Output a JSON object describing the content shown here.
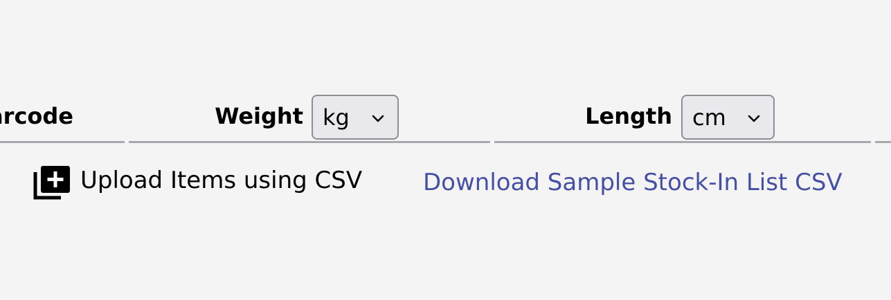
{
  "headers": {
    "barcode": "arcode",
    "weight": "Weight",
    "length": "Length"
  },
  "units": {
    "weight": {
      "selected": "kg"
    },
    "length": {
      "selected": "cm"
    }
  },
  "upload": {
    "label": "Upload Items using CSV",
    "icon": "library-add-icon"
  },
  "download": {
    "label": "Download Sample Stock-In List CSV"
  },
  "colors": {
    "background": "#f4f4f4",
    "link": "#4550a5",
    "select_background": "#e9e8ed",
    "select_border": "#8e8d95",
    "underline": "#a9a8af"
  }
}
